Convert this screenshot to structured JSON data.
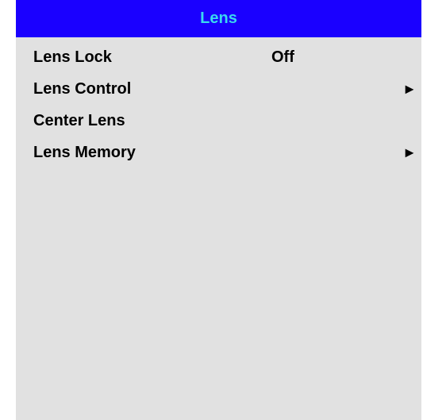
{
  "menu": {
    "title": "Lens",
    "colors": {
      "title_background": "#1a00ff",
      "title_text": "#3ad8f0",
      "panel_background": "#e1e1e1"
    },
    "items": [
      {
        "label": "Lens Lock",
        "value": "Off"
      },
      {
        "label": "Lens Control",
        "submenu_icon": "right-triangle-icon"
      },
      {
        "label": "Center Lens"
      },
      {
        "label": "Lens Memory",
        "submenu_icon": "right-triangle-icon"
      }
    ]
  }
}
